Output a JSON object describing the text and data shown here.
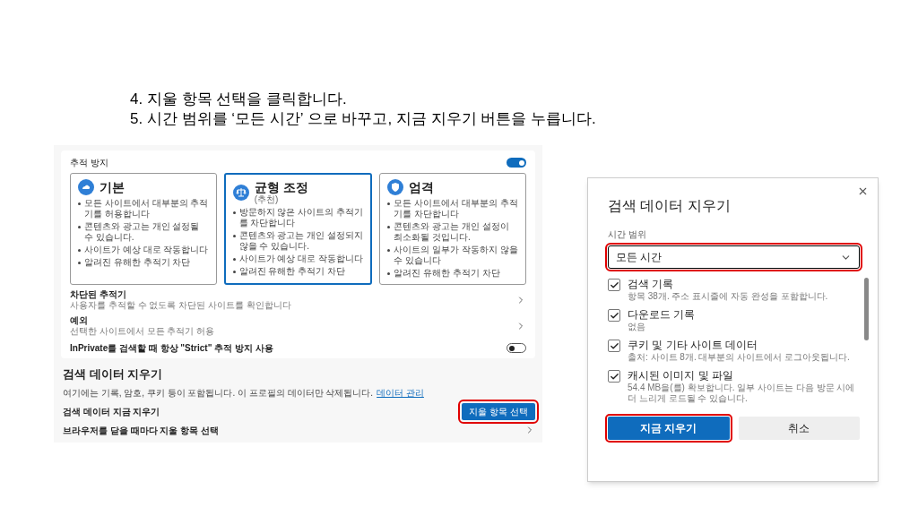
{
  "instructions": [
    "4. 지울 항목 선택을 클릭합니다.",
    "5. 시간 범위를 ‘모든 시간’ 으로 바꾸고, 지금 지우기 버튼을 누릅니다."
  ],
  "settings": {
    "tracking": {
      "title": "추적 방지",
      "on": true,
      "levels": [
        {
          "name": "기본",
          "selected": false,
          "bullets": [
            "모든 사이트에서 대부분의 추적기를 허용합니다",
            "콘텐츠와 광고는 개인 설정될 수 있습니다.",
            "사이트가 예상 대로 작동합니다",
            "알려진 유해한 추적기 차단"
          ]
        },
        {
          "name": "균형 조정",
          "note": "(추천)",
          "selected": true,
          "bullets": [
            "방문하지 않은 사이트의 추적기를 차단합니다",
            "콘텐츠와 광고는 개인 설정되지 않을 수 있습니다.",
            "사이트가 예상 대로 작동합니다",
            "알려진 유해한 추적기 차단"
          ]
        },
        {
          "name": "엄격",
          "selected": false,
          "bullets": [
            "모든 사이트에서 대부분의 추적기를 차단합니다",
            "콘텐츠와 광고는 개인 설정이 최소화될 것입니다.",
            "사이트의 일부가 작동하지 않을 수 있습니다",
            "알려진 유해한 추적기 차단"
          ]
        }
      ],
      "rows": [
        {
          "title": "차단된 추적기",
          "description": "사용자를 추적할 수 없도록 차단된 사이트를 확인합니다"
        },
        {
          "title": "예외",
          "description": "선택한 사이트에서 모든 추적기 허용"
        }
      ],
      "inprivate": {
        "label": "InPrivate를 검색할 때 항상 \"Strict\" 추적 방지 사용",
        "on": false
      }
    },
    "clear": {
      "title": "검색 데이터 지우기",
      "description": "여기에는 기록, 암호, 쿠키 등이 포함됩니다. 이 프로필의 데이터만 삭제됩니다.",
      "link": "데이터 관리",
      "now": {
        "label": "검색 데이터 지금 지우기",
        "button": "지울 항목 선택",
        "highlighted": true
      },
      "on_close": {
        "label": "브라우저를 닫을 때마다 지울 항목 선택"
      }
    }
  },
  "dialog": {
    "title": "검색 데이터 지우기",
    "time_range": {
      "label": "시간 범위",
      "value": "모든 시간",
      "highlighted": true
    },
    "items": [
      {
        "title": "검색 기록",
        "description": "항목 38개. 주소 표시줄에 자동 완성을 포함합니다.",
        "checked": true
      },
      {
        "title": "다운로드 기록",
        "description": "없음",
        "checked": true
      },
      {
        "title": "쿠키 및 기타 사이트 데이터",
        "description": "출처: 사이트 8개. 대부분의 사이트에서 로그아웃됩니다.",
        "checked": true
      },
      {
        "title": "캐시된 이미지 및 파일",
        "description": "54.4 MB을(를) 확보합니다. 일부 사이트는 다음 방문 시에 더 느리게 로드될 수 있습니다.",
        "checked": true
      }
    ],
    "primary": {
      "label": "지금 지우기",
      "highlighted": true
    },
    "cancel": "취소"
  }
}
